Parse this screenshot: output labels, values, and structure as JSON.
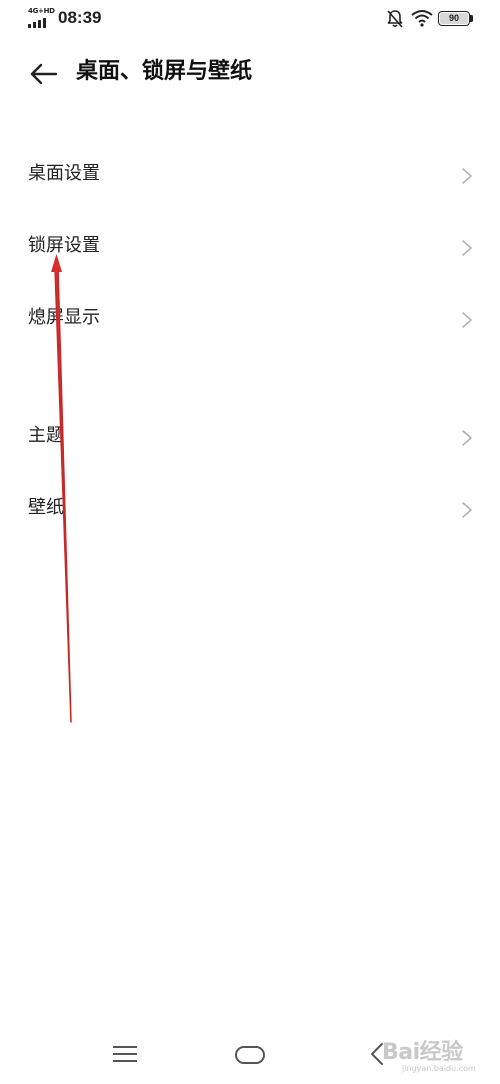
{
  "status_bar": {
    "network": "4G+HD",
    "time": "08:39",
    "battery": "90",
    "icons": [
      "signal-icon",
      "mute-bell-icon",
      "wifi-icon",
      "battery-icon"
    ]
  },
  "header": {
    "title": "桌面、锁屏与壁纸",
    "back_icon": "back-arrow-icon"
  },
  "settings": {
    "group1": [
      {
        "label": "桌面设置"
      },
      {
        "label": "锁屏设置"
      },
      {
        "label": "熄屏显示"
      }
    ],
    "group2": [
      {
        "label": "主题"
      },
      {
        "label": "壁纸"
      }
    ]
  },
  "nav_bar": {
    "icons": [
      "menu-icon",
      "home-icon",
      "back-icon"
    ]
  },
  "watermark": {
    "text": "Bai经验",
    "sub": "jingyan.baidu.com"
  },
  "colors": {
    "background": "#ffffff",
    "text": "#222222",
    "chevron": "#b0b0b0",
    "annotation": "#d32f2f"
  }
}
